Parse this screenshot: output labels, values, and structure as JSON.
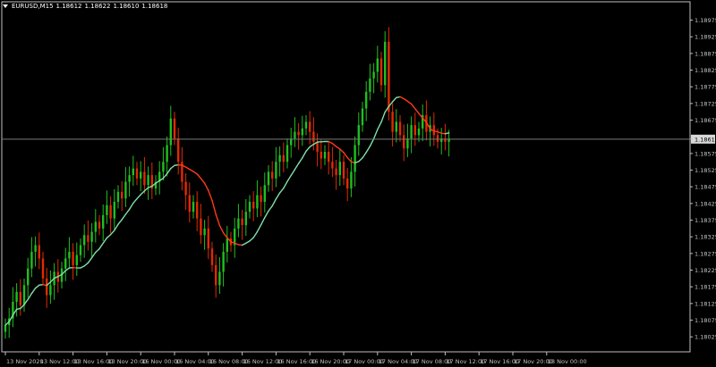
{
  "header": {
    "symbol": "EURUSD,M15",
    "open": "1.18612",
    "high": "1.18622",
    "low": "1.18610",
    "close": "1.18618"
  },
  "colors": {
    "background": "#000000",
    "axis": "#c0c0c0",
    "bull": "#1fbf1f",
    "bear": "#e02a00",
    "ma_up": "#7fe0a8",
    "ma_down": "#ff3a1a",
    "price_line": "#7a7a7a",
    "price_tag_bg": "#d8d8d8"
  },
  "chart_data": {
    "type": "candlestick",
    "ylim": [
      1.1798,
      1.1903
    ],
    "y_ticks": [
      "1.18975",
      "1.18925",
      "1.18875",
      "1.18825",
      "1.18775",
      "1.18725",
      "1.18675",
      "1.18618",
      "1.18575",
      "1.18525",
      "1.18475",
      "1.18425",
      "1.18375",
      "1.18325",
      "1.18275",
      "1.18225",
      "1.18175",
      "1.18125",
      "1.18075",
      "1.18025"
    ],
    "y_tick_values": [
      1.18975,
      1.18925,
      1.18875,
      1.18825,
      1.18775,
      1.18725,
      1.18675,
      1.18618,
      1.18575,
      1.18525,
      1.18475,
      1.18425,
      1.18375,
      1.18325,
      1.18275,
      1.18225,
      1.18175,
      1.18125,
      1.18075,
      1.18025
    ],
    "current_price": 1.18618,
    "x_ticks": [
      "13 Nov 2020",
      "13 Nov 12:00",
      "13 Nov 16:00",
      "13 Nov 20:00",
      "16 Nov 00:00",
      "16 Nov 04:00",
      "16 Nov 08:00",
      "16 Nov 12:00",
      "16 Nov 16:00",
      "16 Nov 20:00",
      "17 Nov 00:00",
      "17 Nov 04:00",
      "17 Nov 08:00",
      "17 Nov 12:00",
      "17 Nov 16:00",
      "17 Nov 20:00",
      "18 Nov 00:00"
    ],
    "x_tick_bar_index": [
      0,
      9,
      18,
      27,
      36,
      45,
      54,
      63,
      72,
      81,
      90,
      99,
      108,
      117,
      126,
      135,
      144
    ],
    "closes": [
      1.1806,
      1.1808,
      1.1813,
      1.1816,
      1.1812,
      1.1818,
      1.1823,
      1.1828,
      1.183,
      1.1826,
      1.182,
      1.1815,
      1.1818,
      1.1822,
      1.1819,
      1.1823,
      1.1826,
      1.1828,
      1.1824,
      1.1827,
      1.183,
      1.1833,
      1.1831,
      1.1834,
      1.1837,
      1.1835,
      1.1839,
      1.1842,
      1.1838,
      1.1843,
      1.1846,
      1.1844,
      1.1849,
      1.1851,
      1.1853,
      1.185,
      1.1852,
      1.1848,
      1.1851,
      1.1847,
      1.1849,
      1.1852,
      1.1855,
      1.186,
      1.1868,
      1.1862,
      1.1855,
      1.1849,
      1.1845,
      1.184,
      1.1843,
      1.1838,
      1.1833,
      1.1835,
      1.1829,
      1.1824,
      1.1818,
      1.1822,
      1.1828,
      1.1832,
      1.183,
      1.1835,
      1.1838,
      1.1836,
      1.184,
      1.1843,
      1.1841,
      1.1845,
      1.1843,
      1.1848,
      1.1852,
      1.185,
      1.1855,
      1.1857,
      1.1855,
      1.186,
      1.1862,
      1.1864,
      1.1863,
      1.1865,
      1.1867,
      1.1864,
      1.1861,
      1.1858,
      1.1856,
      1.1858,
      1.1855,
      1.1853,
      1.1851,
      1.1855,
      1.185,
      1.1847,
      1.1852,
      1.186,
      1.1866,
      1.1871,
      1.1876,
      1.188,
      1.1882,
      1.1886,
      1.1878,
      1.1891,
      1.187,
      1.1864,
      1.1867,
      1.1863,
      1.1859,
      1.1862,
      1.1866,
      1.1863,
      1.1865,
      1.1869,
      1.1864,
      1.1866,
      1.1863,
      1.1861,
      1.1862,
      1.1861,
      1.1862
    ]
  }
}
